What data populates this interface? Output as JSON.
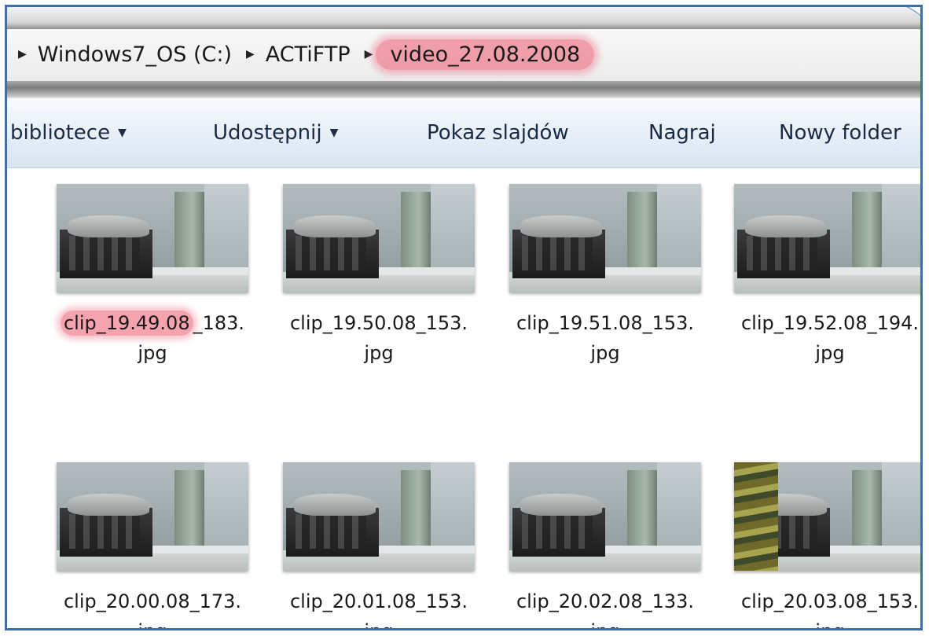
{
  "breadcrumb": {
    "items": [
      "Windows7_OS (C:)",
      "ACTiFTP"
    ],
    "highlighted": "video_27.08.2008"
  },
  "toolbar": {
    "library": "bibliotece",
    "share": "Udostępnij",
    "slideshow": "Pokaz slajdów",
    "burn": "Nagraj",
    "new_folder": "Nowy folder"
  },
  "files": [
    {
      "name_hl": "clip_19.49.08",
      "name_rest": "_183.",
      "ext": "jpg"
    },
    {
      "name_hl": "",
      "name_rest": "clip_19.50.08_153.",
      "ext": "jpg"
    },
    {
      "name_hl": "",
      "name_rest": "clip_19.51.08_153.",
      "ext": "jpg"
    },
    {
      "name_hl": "",
      "name_rest": "clip_19.52.08_194.",
      "ext": "jpg"
    },
    {
      "name_hl": "",
      "name_rest": "clip_20.00.08_173.",
      "ext": "jpg"
    },
    {
      "name_hl": "",
      "name_rest": "clip_20.01.08_153.",
      "ext": "jpg"
    },
    {
      "name_hl": "",
      "name_rest": "clip_20.02.08_133.",
      "ext": "jpg"
    },
    {
      "name_hl": "",
      "name_rest": "clip_20.03.08_153.",
      "ext": "jpg"
    }
  ],
  "colors": {
    "frame_border": "#3d6fb0",
    "highlight": "#ee5870"
  }
}
